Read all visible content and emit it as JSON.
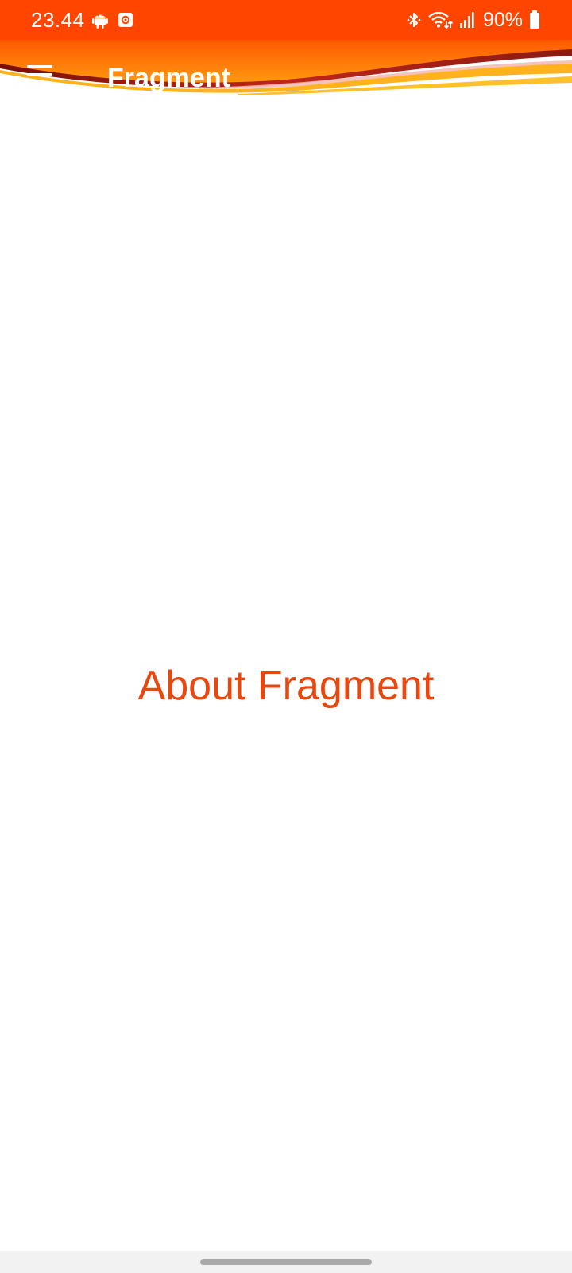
{
  "status_bar": {
    "time": "23.44",
    "battery": "90%",
    "left_icons": [
      "android-icon",
      "screen-record-icon"
    ],
    "right_icons": [
      "bluetooth-icon",
      "wifi-icon",
      "signal-icon",
      "battery-icon"
    ]
  },
  "toolbar": {
    "title": "Fragment",
    "menu_icon": "hamburger-menu-icon"
  },
  "main": {
    "text": "About Fragment"
  },
  "colors": {
    "status_bar": "#ff4500",
    "toolbar_orange": "#ff7a00",
    "wave_red": "#c0261a",
    "wave_yellow": "#ffc12a",
    "content_text": "#e8470e",
    "nav_bar": "#f2f2f2"
  }
}
